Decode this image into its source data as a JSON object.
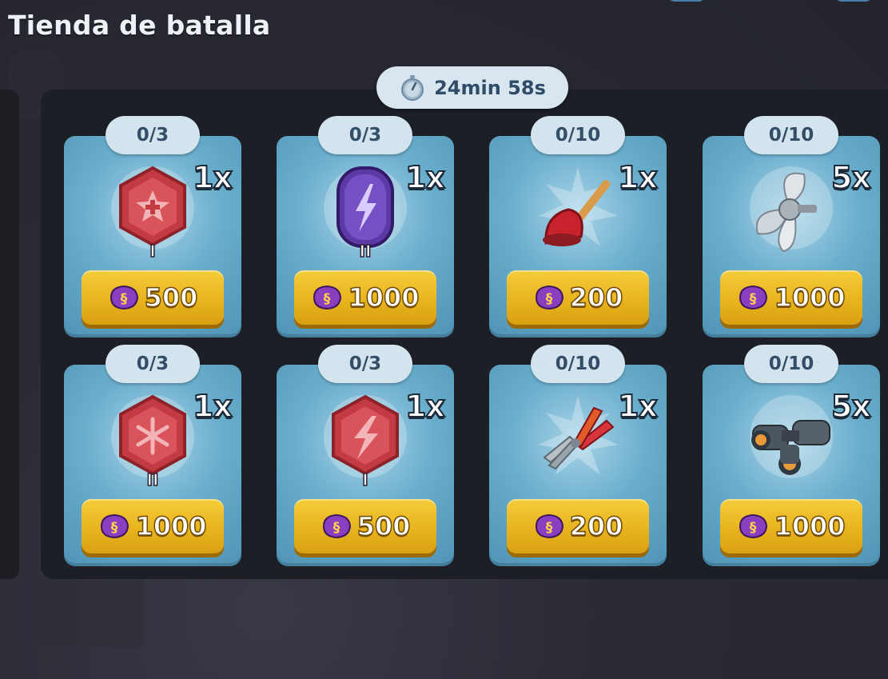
{
  "shop": {
    "title": "Tienda de batalla",
    "timer": "24min 58s"
  },
  "items": [
    {
      "progress": "0/3",
      "multiplier": "1x",
      "price": "500",
      "icon": "red-hexagon-star-badge-icon",
      "tier": "I"
    },
    {
      "progress": "0/3",
      "multiplier": "1x",
      "price": "1000",
      "icon": "purple-lightning-badge-icon",
      "tier": "II"
    },
    {
      "progress": "0/10",
      "multiplier": "1x",
      "price": "200",
      "icon": "plunger-icon"
    },
    {
      "progress": "0/10",
      "multiplier": "5x",
      "price": "1000",
      "icon": "propeller-icon"
    },
    {
      "progress": "0/3",
      "multiplier": "1x",
      "price": "1000",
      "icon": "red-hexagon-snowflake-badge-icon",
      "tier": "II"
    },
    {
      "progress": "0/3",
      "multiplier": "1x",
      "price": "500",
      "icon": "red-hexagon-lightning-badge-icon",
      "tier": "I"
    },
    {
      "progress": "0/10",
      "multiplier": "1x",
      "price": "200",
      "icon": "pliers-icon"
    },
    {
      "progress": "0/10",
      "multiplier": "5x",
      "price": "1000",
      "icon": "binoculars-icon"
    }
  ],
  "colors": {
    "card": "#6aaecd",
    "price_button": "#e7b21c",
    "pill": "#d4e4ee",
    "currency": "#8a3fc0"
  }
}
